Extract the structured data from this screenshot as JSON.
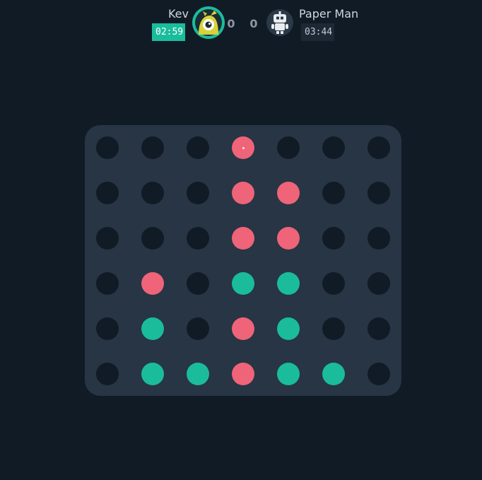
{
  "players": [
    {
      "name": "Kev",
      "timer": "02:59",
      "score": "0",
      "avatar_icon": "one-eyed-monster-avatar-icon",
      "color": "#1abc9c",
      "active": true
    },
    {
      "name": "Paper Man",
      "timer": "03:44",
      "score": "0",
      "avatar_icon": "robot-avatar-icon",
      "color": "#ef6478",
      "active": false
    }
  ],
  "board": {
    "columns": 7,
    "rows": 6,
    "cells": [
      [
        "empty",
        "empty",
        "empty",
        "red",
        "empty",
        "empty",
        "empty"
      ],
      [
        "empty",
        "empty",
        "empty",
        "red",
        "red",
        "empty",
        "empty"
      ],
      [
        "empty",
        "empty",
        "empty",
        "red",
        "red",
        "empty",
        "empty"
      ],
      [
        "empty",
        "red",
        "empty",
        "green",
        "green",
        "empty",
        "empty"
      ],
      [
        "empty",
        "green",
        "empty",
        "red",
        "green",
        "empty",
        "empty"
      ],
      [
        "empty",
        "green",
        "green",
        "red",
        "green",
        "green",
        "empty"
      ]
    ],
    "last_move": {
      "row": 0,
      "column": 3
    }
  },
  "colors": {
    "background": "#111b26",
    "board": "#273545",
    "empty": "#111b26",
    "red": "#ef6478",
    "green": "#1abc9c"
  }
}
